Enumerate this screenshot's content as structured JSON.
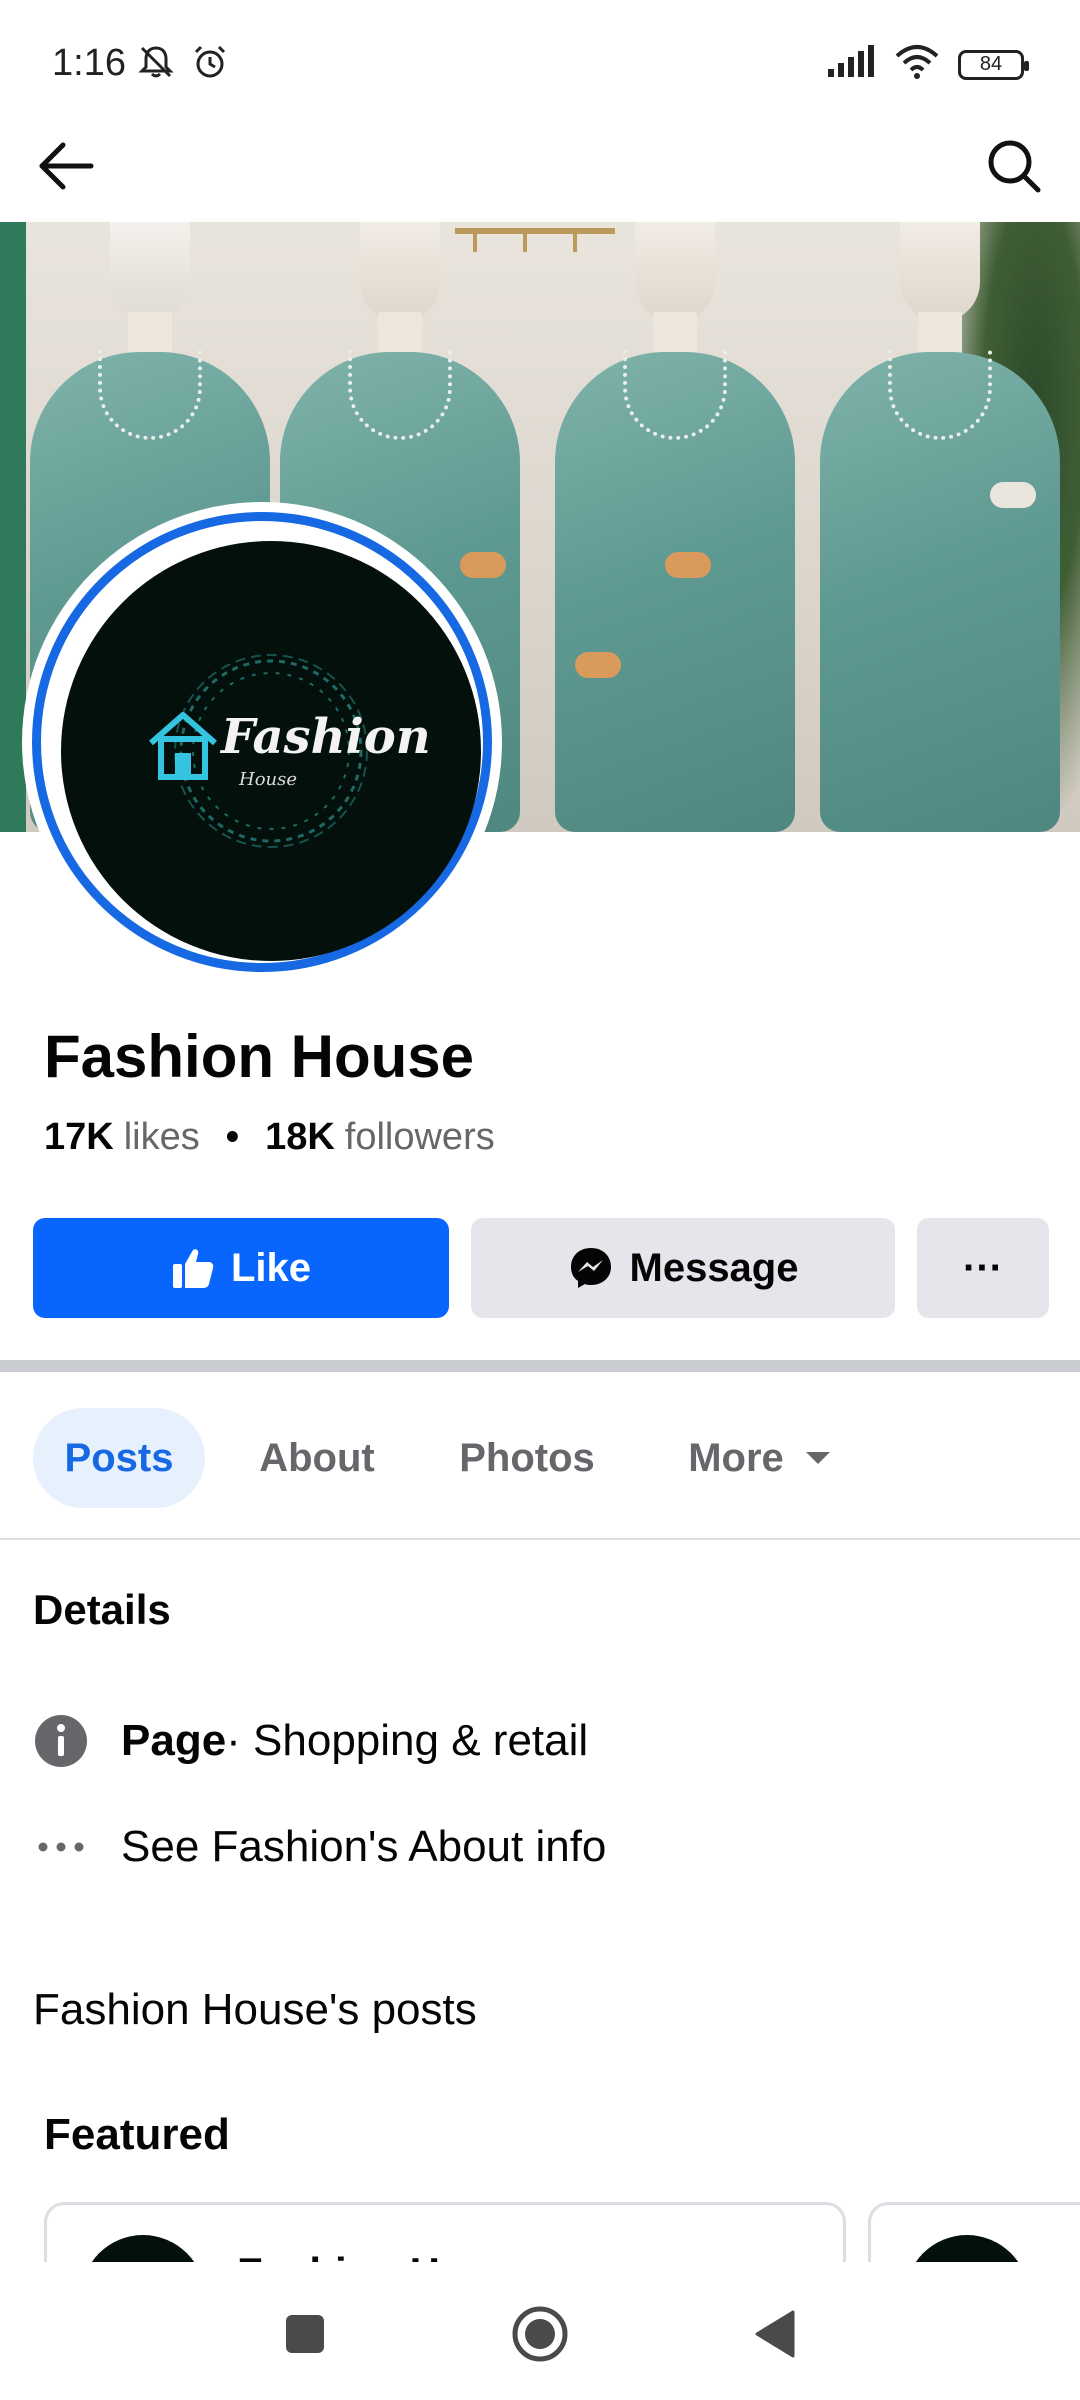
{
  "status_bar": {
    "time": "1:16",
    "battery": "84",
    "icons": [
      "mute-icon",
      "alarm-icon",
      "signal-icon",
      "wifi-icon",
      "battery-icon"
    ]
  },
  "app_bar": {
    "back_icon": "arrow-left-icon",
    "search_icon": "search-icon"
  },
  "profile": {
    "logo_text": "Fashion",
    "logo_subtext": "House",
    "name": "Fashion House",
    "likes_count": "17K",
    "likes_label": "likes",
    "followers_count": "18K",
    "followers_label": "followers"
  },
  "actions": {
    "like_label": "Like",
    "message_label": "Message",
    "more_label": "···"
  },
  "tabs": [
    {
      "label": "Posts",
      "selected": true
    },
    {
      "label": "About",
      "selected": false
    },
    {
      "label": "Photos",
      "selected": false
    },
    {
      "label": "More",
      "selected": false
    }
  ],
  "details": {
    "title": "Details",
    "category_prefix": "Page",
    "category_value": " · Shopping & retail",
    "about_link": "See Fashion's About info"
  },
  "posts": {
    "title": "Fashion House's posts",
    "featured_title": "Featured",
    "card_name": "Fashion H"
  },
  "colors": {
    "accent": "#0866ff",
    "tab_selected_bg": "#e7f0fd",
    "tab_selected_text": "#1668e3",
    "button_gray": "#e4e6eb"
  }
}
